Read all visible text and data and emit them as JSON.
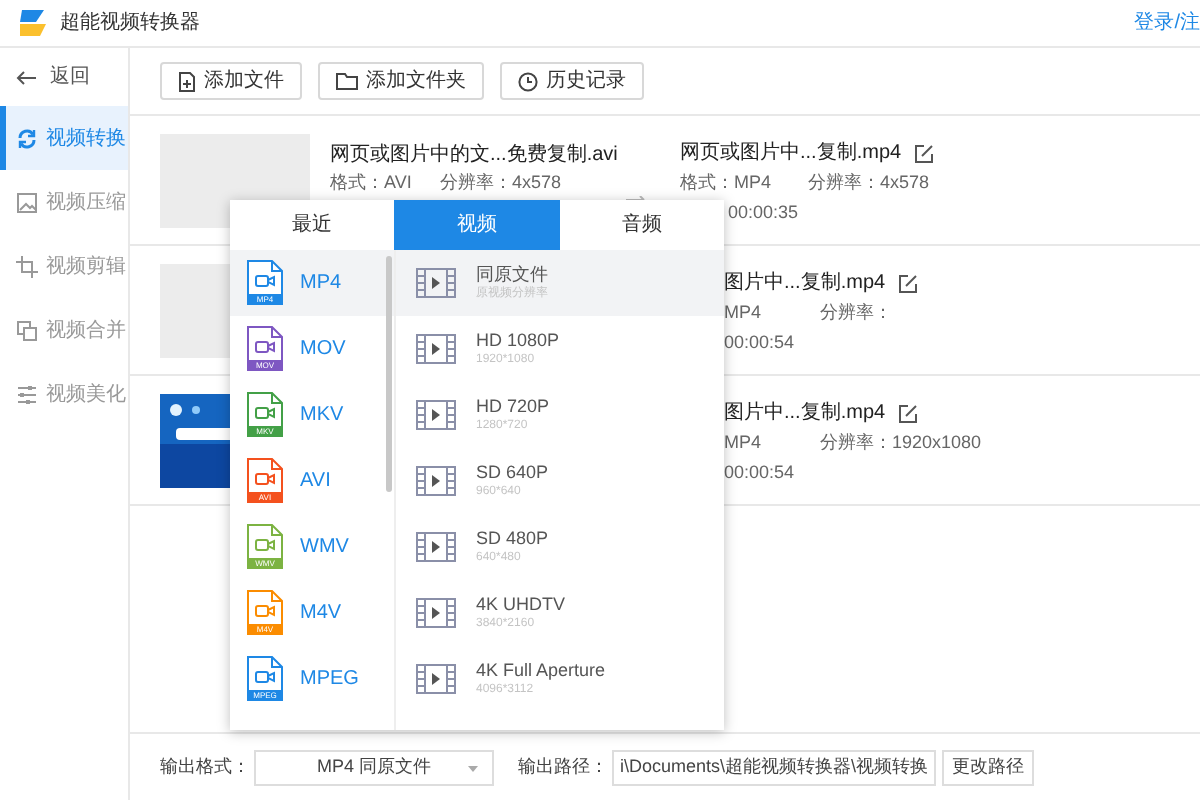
{
  "window": {
    "title": "超能视频转换器"
  },
  "account_link": "登录/注",
  "sidebar": {
    "back": "返回",
    "items": [
      {
        "label": "视频转换",
        "selected": true
      },
      {
        "label": "视频压缩",
        "selected": false
      },
      {
        "label": "视频剪辑",
        "selected": false
      },
      {
        "label": "视频合并",
        "selected": false
      },
      {
        "label": "视频美化",
        "selected": false
      }
    ]
  },
  "toolbar": [
    "添加文件",
    "添加文件夹",
    "历史记录"
  ],
  "files": [
    {
      "thumbnail": {
        "kind": "blank"
      },
      "source": {
        "name": "网页或图片中的文...免费复制.avi",
        "format": "格式：AVI",
        "resolution": "分辨率：4x578"
      },
      "output": {
        "name": "网页或图片中...复制.mp4",
        "format": "格式：MP4",
        "resolution": "分辨率：4x578",
        "duration": "00:00:35"
      }
    },
    {
      "thumbnail": {
        "kind": "blank"
      },
      "output": {
        "name": "图片中...复制.mp4",
        "format": "MP4",
        "resolution": "分辨率：",
        "duration": "00:00:54"
      }
    },
    {
      "output": {
        "name": "图片中...复制.mp4",
        "format": "MP4",
        "resolution": "分辨率：1920x1080",
        "duration": "00:00:54"
      }
    }
  ],
  "format_popup": {
    "tabs": [
      {
        "label": "最近",
        "selected": false
      },
      {
        "label": "视频",
        "selected": true
      },
      {
        "label": "音频",
        "selected": false
      }
    ],
    "formats": [
      {
        "label": "MP4",
        "icon_label": "MP4",
        "color": "#1e88e5",
        "selected": true
      },
      {
        "label": "MOV",
        "icon_label": "MOV",
        "color": "#7e57c2",
        "selected": false
      },
      {
        "label": "MKV",
        "icon_label": "MKV",
        "color": "#43a047",
        "selected": false
      },
      {
        "label": "AVI",
        "icon_label": "AVI",
        "color": "#f4511e",
        "selected": false
      },
      {
        "label": "WMV",
        "icon_label": "WMV",
        "color": "#7cb342",
        "selected": false
      },
      {
        "label": "M4V",
        "icon_label": "M4V",
        "color": "#fb8c00",
        "selected": false
      },
      {
        "label": "MPEG",
        "icon_label": "MPEG",
        "color": "#1e88e5",
        "selected": false
      }
    ],
    "presets": [
      {
        "name": "同原文件",
        "size": "原视频分辨率",
        "selected": true
      },
      {
        "name": "HD 1080P",
        "size": "1920*1080",
        "selected": false
      },
      {
        "name": "HD 720P",
        "size": "1280*720",
        "selected": false
      },
      {
        "name": "SD 640P",
        "size": "960*640",
        "selected": false
      },
      {
        "name": "SD 480P",
        "size": "640*480",
        "selected": false
      },
      {
        "name": "4K UHDTV",
        "size": "3840*2160",
        "selected": false
      },
      {
        "name": "4K Full Aperture",
        "size": "4096*3112",
        "selected": false
      }
    ]
  },
  "output_format": {
    "label": "输出格式：",
    "value": "MP4 同原文件"
  },
  "output_path": {
    "label": "输出路径：",
    "value": "i\\Documents\\超能视频转换器\\视频转换",
    "button": "更改路径"
  }
}
